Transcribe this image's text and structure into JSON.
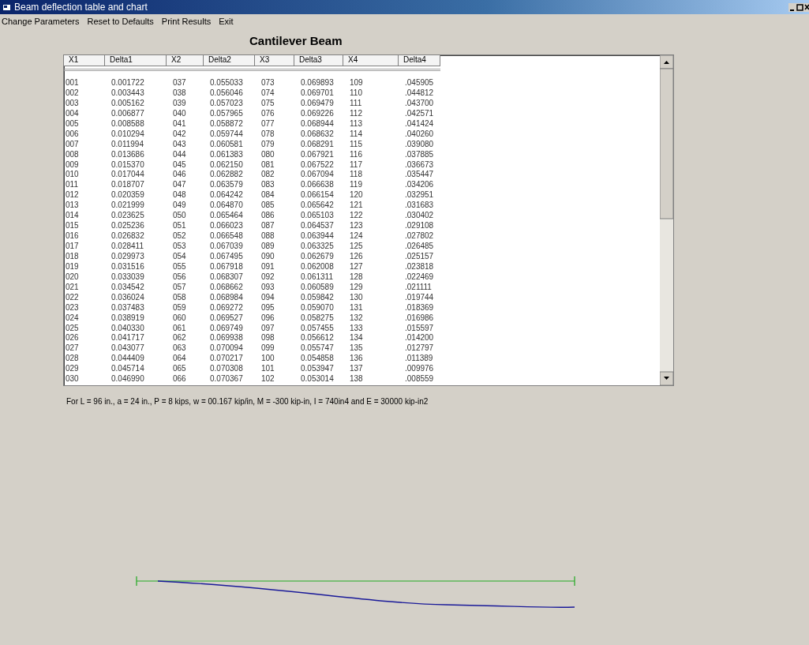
{
  "window": {
    "title": "Beam deflection table and chart"
  },
  "menu": [
    "Change Parameters",
    "Reset to Defaults",
    "Print Results",
    "Exit"
  ],
  "heading": "Cantilever Beam",
  "table": {
    "columns": [
      "X1",
      "Delta1",
      "X2",
      "Delta2",
      "X3",
      "Delta3",
      "X4",
      "Delta4"
    ],
    "rows": [
      [
        "001",
        "0.001722",
        "037",
        "0.055033",
        "073",
        "0.069893",
        "109",
        ".045905"
      ],
      [
        "002",
        "0.003443",
        "038",
        "0.056046",
        "074",
        "0.069701",
        "110",
        ".044812"
      ],
      [
        "003",
        "0.005162",
        "039",
        "0.057023",
        "075",
        "0.069479",
        "111",
        ".043700"
      ],
      [
        "004",
        "0.006877",
        "040",
        "0.057965",
        "076",
        "0.069226",
        "112",
        ".042571"
      ],
      [
        "005",
        "0.008588",
        "041",
        "0.058872",
        "077",
        "0.068944",
        "113",
        ".041424"
      ],
      [
        "006",
        "0.010294",
        "042",
        "0.059744",
        "078",
        "0.068632",
        "114",
        ".040260"
      ],
      [
        "007",
        "0.011994",
        "043",
        "0.060581",
        "079",
        "0.068291",
        "115",
        ".039080"
      ],
      [
        "008",
        "0.013686",
        "044",
        "0.061383",
        "080",
        "0.067921",
        "116",
        ".037885"
      ],
      [
        "009",
        "0.015370",
        "045",
        "0.062150",
        "081",
        "0.067522",
        "117",
        ".036673"
      ],
      [
        "010",
        "0.017044",
        "046",
        "0.062882",
        "082",
        "0.067094",
        "118",
        ".035447"
      ],
      [
        "011",
        "0.018707",
        "047",
        "0.063579",
        "083",
        "0.066638",
        "119",
        ".034206"
      ],
      [
        "012",
        "0.020359",
        "048",
        "0.064242",
        "084",
        "0.066154",
        "120",
        ".032951"
      ],
      [
        "013",
        "0.021999",
        "049",
        "0.064870",
        "085",
        "0.065642",
        "121",
        ".031683"
      ],
      [
        "014",
        "0.023625",
        "050",
        "0.065464",
        "086",
        "0.065103",
        "122",
        ".030402"
      ],
      [
        "015",
        "0.025236",
        "051",
        "0.066023",
        "087",
        "0.064537",
        "123",
        ".029108"
      ],
      [
        "016",
        "0.026832",
        "052",
        "0.066548",
        "088",
        "0.063944",
        "124",
        ".027802"
      ],
      [
        "017",
        "0.028411",
        "053",
        "0.067039",
        "089",
        "0.063325",
        "125",
        ".026485"
      ],
      [
        "018",
        "0.029973",
        "054",
        "0.067495",
        "090",
        "0.062679",
        "126",
        ".025157"
      ],
      [
        "019",
        "0.031516",
        "055",
        "0.067918",
        "091",
        "0.062008",
        "127",
        ".023818"
      ],
      [
        "020",
        "0.033039",
        "056",
        "0.068307",
        "092",
        "0.061311",
        "128",
        ".022469"
      ],
      [
        "021",
        "0.034542",
        "057",
        "0.068662",
        "093",
        "0.060589",
        "129",
        ".021111"
      ],
      [
        "022",
        "0.036024",
        "058",
        "0.068984",
        "094",
        "0.059842",
        "130",
        ".019744"
      ],
      [
        "023",
        "0.037483",
        "059",
        "0.069272",
        "095",
        "0.059070",
        "131",
        ".018369"
      ],
      [
        "024",
        "0.038919",
        "060",
        "0.069527",
        "096",
        "0.058275",
        "132",
        ".016986"
      ],
      [
        "025",
        "0.040330",
        "061",
        "0.069749",
        "097",
        "0.057455",
        "133",
        ".015597"
      ],
      [
        "026",
        "0.041717",
        "062",
        "0.069938",
        "098",
        "0.056612",
        "134",
        ".014200"
      ],
      [
        "027",
        "0.043077",
        "063",
        "0.070094",
        "099",
        "0.055747",
        "135",
        ".012797"
      ],
      [
        "028",
        "0.044409",
        "064",
        "0.070217",
        "100",
        "0.054858",
        "136",
        ".011389"
      ],
      [
        "029",
        "0.045714",
        "065",
        "0.070308",
        "101",
        "0.053947",
        "137",
        ".009976"
      ],
      [
        "030",
        "0.046990",
        "066",
        "0.070367",
        "102",
        "0.053014",
        "138",
        ".008559"
      ]
    ]
  },
  "note": "For L = 96 in., a = 24 in., P = 8 kips, w = 00.167 kip/in, M = -300 kip-in, I = 740in4 and E = 30000 kip-in2"
}
